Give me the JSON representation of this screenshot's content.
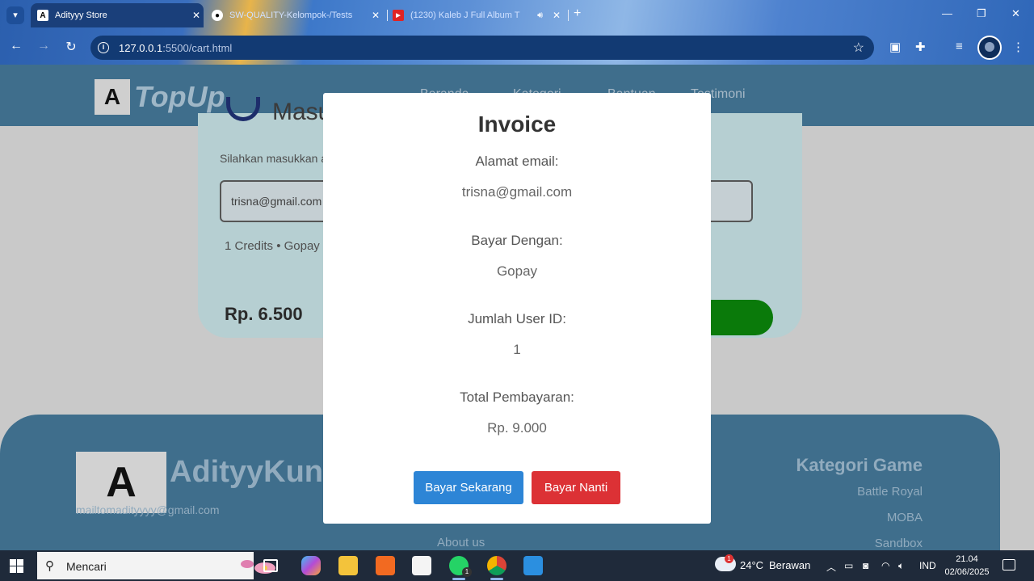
{
  "browser": {
    "tabs": [
      {
        "title": "Adityyy Store"
      },
      {
        "title": "SW-QUALITY-Kelompok-/Tests"
      },
      {
        "title": "(1230) Kaleb J Full Album T"
      }
    ],
    "url_host": "127.0.0.1",
    "url_path": ":5500/cart.html"
  },
  "site": {
    "logo_letter": "A",
    "logo_text": "TopUp",
    "nav": [
      "Beranda",
      "Kategori",
      "Bantuan",
      "Testimoni"
    ]
  },
  "card": {
    "title": "Masukkan Email",
    "subtitle": "Silahkan masukkan alamat email anda",
    "email_value": "trisna@gmail.com",
    "info": "1 Credits • Gopay",
    "price": "Rp. 6.500"
  },
  "footer": {
    "brand": "AdityyKun",
    "email": "mailtomadityyyy@gmail.com",
    "about": "About us",
    "category_title": "Kategori Game",
    "categories": [
      "Battle Royal",
      "MOBA",
      "Sandbox"
    ]
  },
  "invoice": {
    "title": "Invoice",
    "email_label": "Alamat email:",
    "email_value": "trisna@gmail.com",
    "pay_label": "Bayar Dengan:",
    "pay_value": "Gopay",
    "users_label": "Jumlah User ID:",
    "users_value": "1",
    "total_label": "Total Pembayaran:",
    "total_value": "Rp. 9.000",
    "pay_now": "Bayar Sekarang",
    "pay_later": "Bayar Nanti"
  },
  "taskbar": {
    "search_text": "Mencari",
    "whatsapp_badge": "1",
    "weather_badge": "1",
    "temperature": "24°C",
    "weather": "Berawan",
    "language": "IND",
    "time": "21.04",
    "date": "02/06/2025"
  },
  "colors": {
    "primary_button": "#2d85d6",
    "danger_button": "#dc3135",
    "navbar": "#3f6e8c"
  }
}
